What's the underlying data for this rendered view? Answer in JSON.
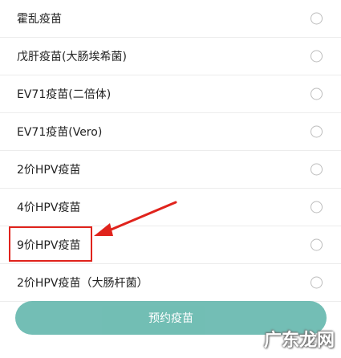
{
  "vaccines": [
    {
      "label": "霍乱疫苗"
    },
    {
      "label": "戊肝疫苗(大肠埃希菌)"
    },
    {
      "label": "EV71疫苗(二倍体)"
    },
    {
      "label": "EV71疫苗(Vero)"
    },
    {
      "label": "2价HPV疫苗"
    },
    {
      "label": "4价HPV疫苗"
    },
    {
      "label": "9价HPV疫苗"
    },
    {
      "label": "2价HPV疫苗（大肠杆菌）"
    }
  ],
  "footer": {
    "book_button_label": "预约疫苗"
  },
  "watermark": {
    "text": "广东龙网"
  },
  "colors": {
    "accent": "#5ab3a8",
    "annotation": "#e0231c"
  }
}
